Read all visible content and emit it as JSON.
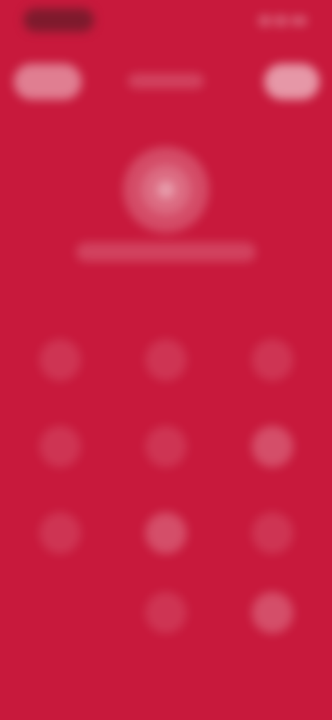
{
  "status_bar": {
    "time": "",
    "icons": [
      "signal-icon",
      "wifi-icon",
      "battery-icon"
    ]
  },
  "top_controls": {
    "left_button_label": "",
    "title": "",
    "right_button_label": ""
  },
  "hero": {
    "avatar_icon": "record-icon",
    "label": ""
  },
  "keypad": {
    "keys": [
      {
        "name": "key-1",
        "label": ""
      },
      {
        "name": "key-2",
        "label": ""
      },
      {
        "name": "key-3",
        "label": ""
      },
      {
        "name": "key-4",
        "label": ""
      },
      {
        "name": "key-5",
        "label": ""
      },
      {
        "name": "key-6",
        "label": ""
      },
      {
        "name": "key-7",
        "label": ""
      },
      {
        "name": "key-8",
        "label": ""
      },
      {
        "name": "key-9",
        "label": ""
      },
      {
        "name": "key-0",
        "label": ""
      },
      {
        "name": "key-action",
        "label": ""
      }
    ]
  }
}
